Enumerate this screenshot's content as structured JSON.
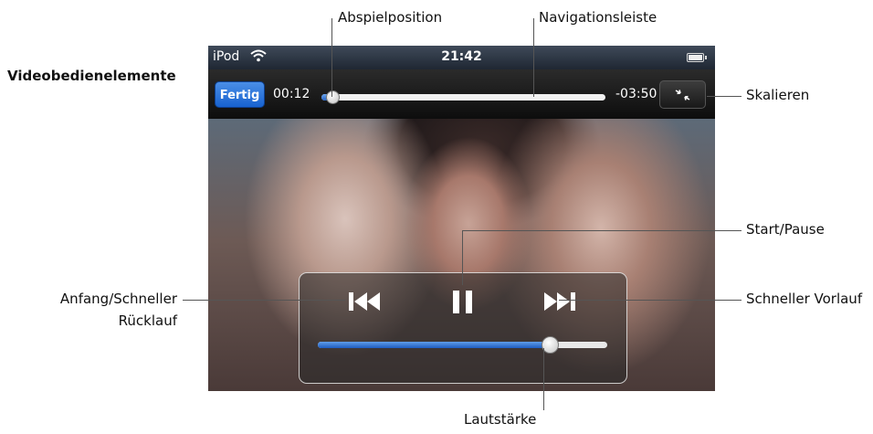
{
  "section_title": "Videobedienelemente",
  "callouts": {
    "playhead": "Abspielposition",
    "scrubber": "Navigationsleiste",
    "scale": "Skalieren",
    "play_pause": "Start/Pause",
    "rewind_line1": "Anfang/Schneller",
    "rewind_line2": "Rücklauf",
    "fast_forward": "Schneller Vorlauf",
    "volume": "Lautstärke"
  },
  "status_bar": {
    "carrier": "iPod",
    "time": "21:42",
    "wifi_icon": "wifi-icon",
    "battery_icon": "battery-icon"
  },
  "player": {
    "done_label": "Fertig",
    "elapsed": "00:12",
    "remaining": "-03:50",
    "progress": 0.03,
    "volume": 0.8,
    "icons": [
      "scale-icon",
      "previous-icon",
      "pause-icon",
      "next-icon"
    ]
  },
  "colors": {
    "accent_blue": "#1a66d4",
    "bar_fill": "#2563c4"
  }
}
